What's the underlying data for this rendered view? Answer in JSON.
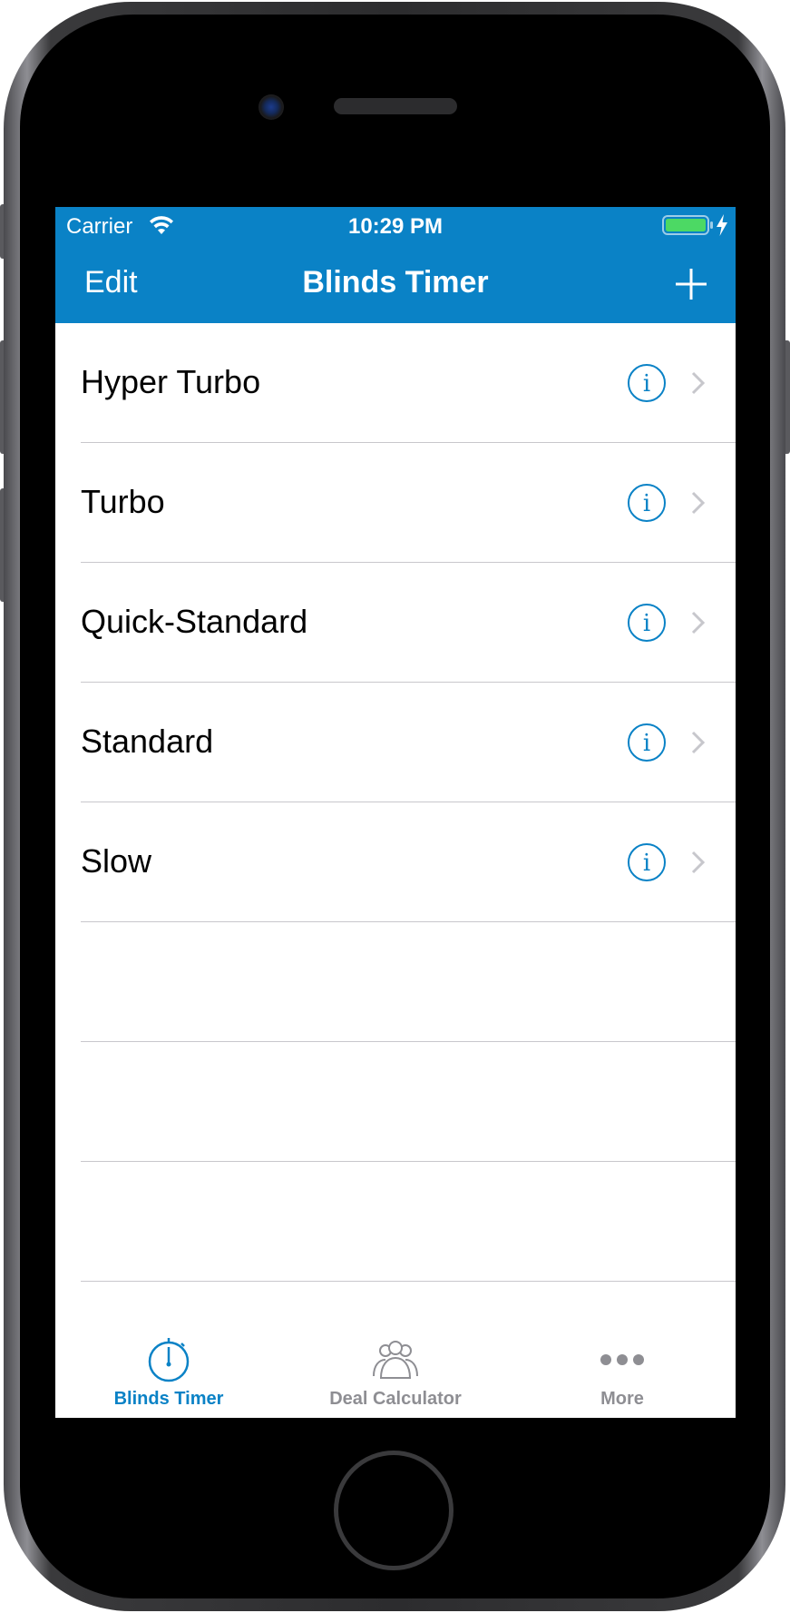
{
  "status_bar": {
    "carrier": "Carrier",
    "time": "10:29 PM",
    "battery_icon": "battery-icon",
    "wifi_icon": "wifi-icon"
  },
  "nav_bar": {
    "left_button": "Edit",
    "title": "Blinds Timer",
    "right_icon": "plus-icon"
  },
  "list": {
    "items": [
      {
        "label": "Hyper Turbo"
      },
      {
        "label": "Turbo"
      },
      {
        "label": "Quick-Standard"
      },
      {
        "label": "Standard"
      },
      {
        "label": "Slow"
      }
    ],
    "info_icon": "info-icon",
    "accessory_icon": "chevron-right-icon"
  },
  "tab_bar": {
    "tabs": [
      {
        "label": "Blinds Timer",
        "icon": "stopwatch-icon",
        "selected": true
      },
      {
        "label": "Deal Calculator",
        "icon": "people-group-icon",
        "selected": false
      },
      {
        "label": "More",
        "icon": "more-dots-icon",
        "selected": false
      }
    ]
  },
  "colors": {
    "accent": "#0a82c6",
    "inactive": "#8e8e93",
    "separator": "#c8c7cc",
    "battery": "#4cd964"
  }
}
